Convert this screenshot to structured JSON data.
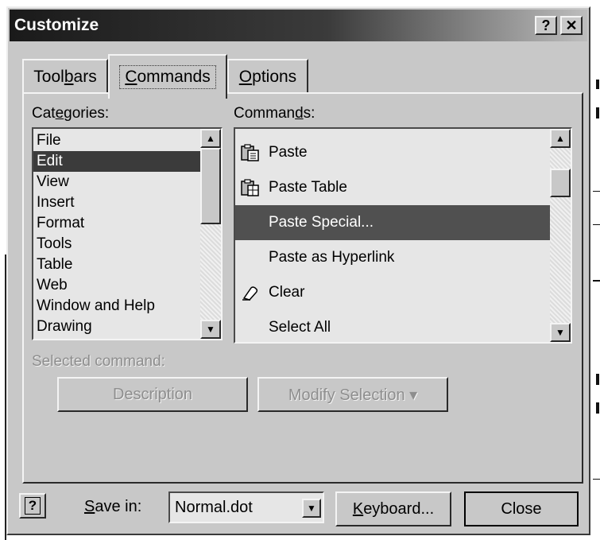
{
  "window": {
    "title": "Customize",
    "help_button": "?",
    "close_button": "✕"
  },
  "tabs": [
    {
      "label_pre": "Tool",
      "label_ul": "b",
      "label_post": "ars"
    },
    {
      "label_pre": "",
      "label_ul": "C",
      "label_post": "ommands"
    },
    {
      "label_pre": "",
      "label_ul": "O",
      "label_post": "ptions"
    }
  ],
  "categories": {
    "label_pre": "Cat",
    "label_ul": "e",
    "label_post": "gories:",
    "items": [
      "File",
      "Edit",
      "View",
      "Insert",
      "Format",
      "Tools",
      "Table",
      "Web",
      "Window and Help",
      "Drawing"
    ],
    "selected": "Edit"
  },
  "commands": {
    "label_pre": "Comman",
    "label_ul": "d",
    "label_post": "s:",
    "items": [
      {
        "label": "Paste",
        "icon": "clipboard-icon"
      },
      {
        "label": "Paste Table",
        "icon": "clipboard-table-icon"
      },
      {
        "label": "Paste Special...",
        "icon": ""
      },
      {
        "label": "Paste as Hyperlink",
        "icon": ""
      },
      {
        "label": "Clear",
        "icon": "eraser-icon"
      },
      {
        "label": "Select All",
        "icon": ""
      }
    ],
    "selected": "Paste Special..."
  },
  "selected_command": {
    "label": "Selected command:",
    "description_button": "Description",
    "modify_button": "Modify Selection ▾"
  },
  "footer": {
    "help_icon": "?",
    "save_in_pre": "",
    "save_in_ul": "S",
    "save_in_post": "ave in:",
    "save_in_value": "Normal.dot",
    "keyboard_pre": "",
    "keyboard_ul": "K",
    "keyboard_post": "eyboard...",
    "close_button": "Close"
  },
  "colors": {
    "dialog_bg": "#c8c8c8",
    "selection": "#3b3b3b",
    "titlebar_start": "#1a1a1a"
  }
}
